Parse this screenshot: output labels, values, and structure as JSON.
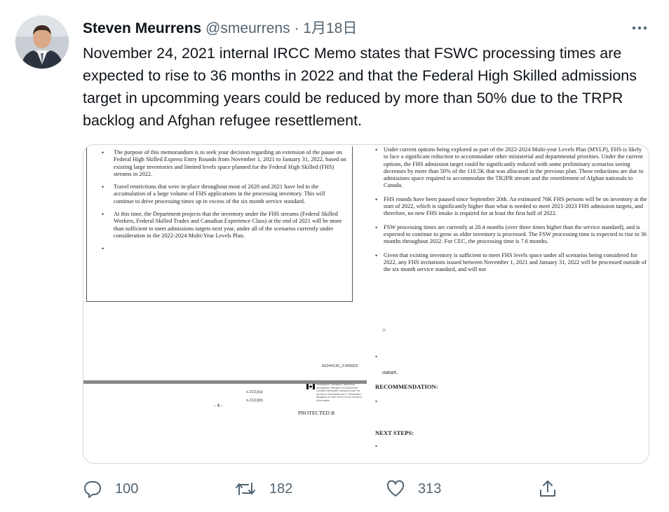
{
  "tweet": {
    "author": {
      "name": "Steven Meurrens",
      "handle": "@smeurrens",
      "separator": "·",
      "date": "1月18日"
    },
    "text": "November 24, 2021 internal IRCC Memo states that FSWC processing times are expected to rise to 36 months in 2022 and that the Federal High Skilled admissions target in upcomming years could be reduced by more than 50% due to the TRPR backlog and Afghan refugee resettlement."
  },
  "media": {
    "left_bullets": [
      "The purpose of this memorandum is to seek your decision regarding an extension of the pause on Federal High Skilled Express Entry Rounds from November 1, 2021 to January 31, 2022, based on existing large inventories and limited levels space planned for the Federal High Skilled (FHS) streams in 2022.",
      "Travel restrictions that were in-place throughout most of 2020 and 2021 have led to the accumulation of a large volume of FHS applications in the processing inventory. This will continue to drive processing times up in excess of the six month service standard.",
      "At this time, the Department projects that the inventory under the FHS streams (Federal Skilled Workers, Federal Skilled Trades and Canadian Experience Class) at the end of 2021 will be more than sufficient to meet admissions targets next year, under all of the scenarios currently under consideration in the 2022-2024 Multi-Year Levels Plan."
    ],
    "bullet_symbol": "•",
    "doc_id": "A3244130_3-000003",
    "exemption_1": "s.21(1)(a)",
    "exemption_2": "s.21(1)(b)",
    "page_number": "- 4 -",
    "protected": "PROTECTED B",
    "gov_text": "Immigration, Refugees  Citizenship  Immigration, Réfugiés et Citoyenneté Canada  Information released under the Access to Information Act / L'information divulguée en vertu de la Loi sur l'accès à l'information",
    "right_bullets": [
      "Under current options being explored as part of the 2022-2024 Multi-year Levels Plan (MYLP), FHS is likely to face a significant reduction to accommodate other ministerial and departmental priorities. Under the current options, the FHS admission target could be significantly reduced with some preliminary scenarios seeing decreases by more than 50% of the 110.5K that was allocated in the previous plan. These reductions are due to admissions space required to accommodate the TR2PR stream and the resettlement of Afghan nationals to Canada.",
      "FHS rounds have been paused since September 20th. An estimated 76K FHS persons will be on inventory at the start of 2022, which is significantly higher than what is needed to meet 2021-2023 FHS admission targets, and therefore, no new FHS intake is required for at least the first half of 2022.",
      "FSW processing times are currently at 20.4 months (over three times higher than the service standard), and is expected to continue to grow as older inventory is processed. The FSW processing time is expected to rise to 36 months throughout 2022. For CEC, the processing time is 7.6 months.",
      "Given that existing inventory is sufficient to meet FHS levels space under all scenarios being considered for 2022, any FHS invitations issued between November 1, 2021 and January 31, 2022 will be processed outside of the six month service standard, and will not"
    ],
    "circle_symbol": "○",
    "outset": "outset.",
    "recommendation_heading": "RECOMMENDATION:",
    "next_steps_heading": "NEXT STEPS:"
  },
  "actions": {
    "reply_count": "100",
    "retweet_count": "182",
    "like_count": "313"
  },
  "icons": [
    "avatar",
    "more-icon",
    "reply-icon",
    "retweet-icon",
    "like-icon",
    "share-icon",
    "canada-flag-icon"
  ],
  "colors": {
    "text": "#0f1419",
    "secondary": "#536471",
    "border": "#cfd9de"
  }
}
